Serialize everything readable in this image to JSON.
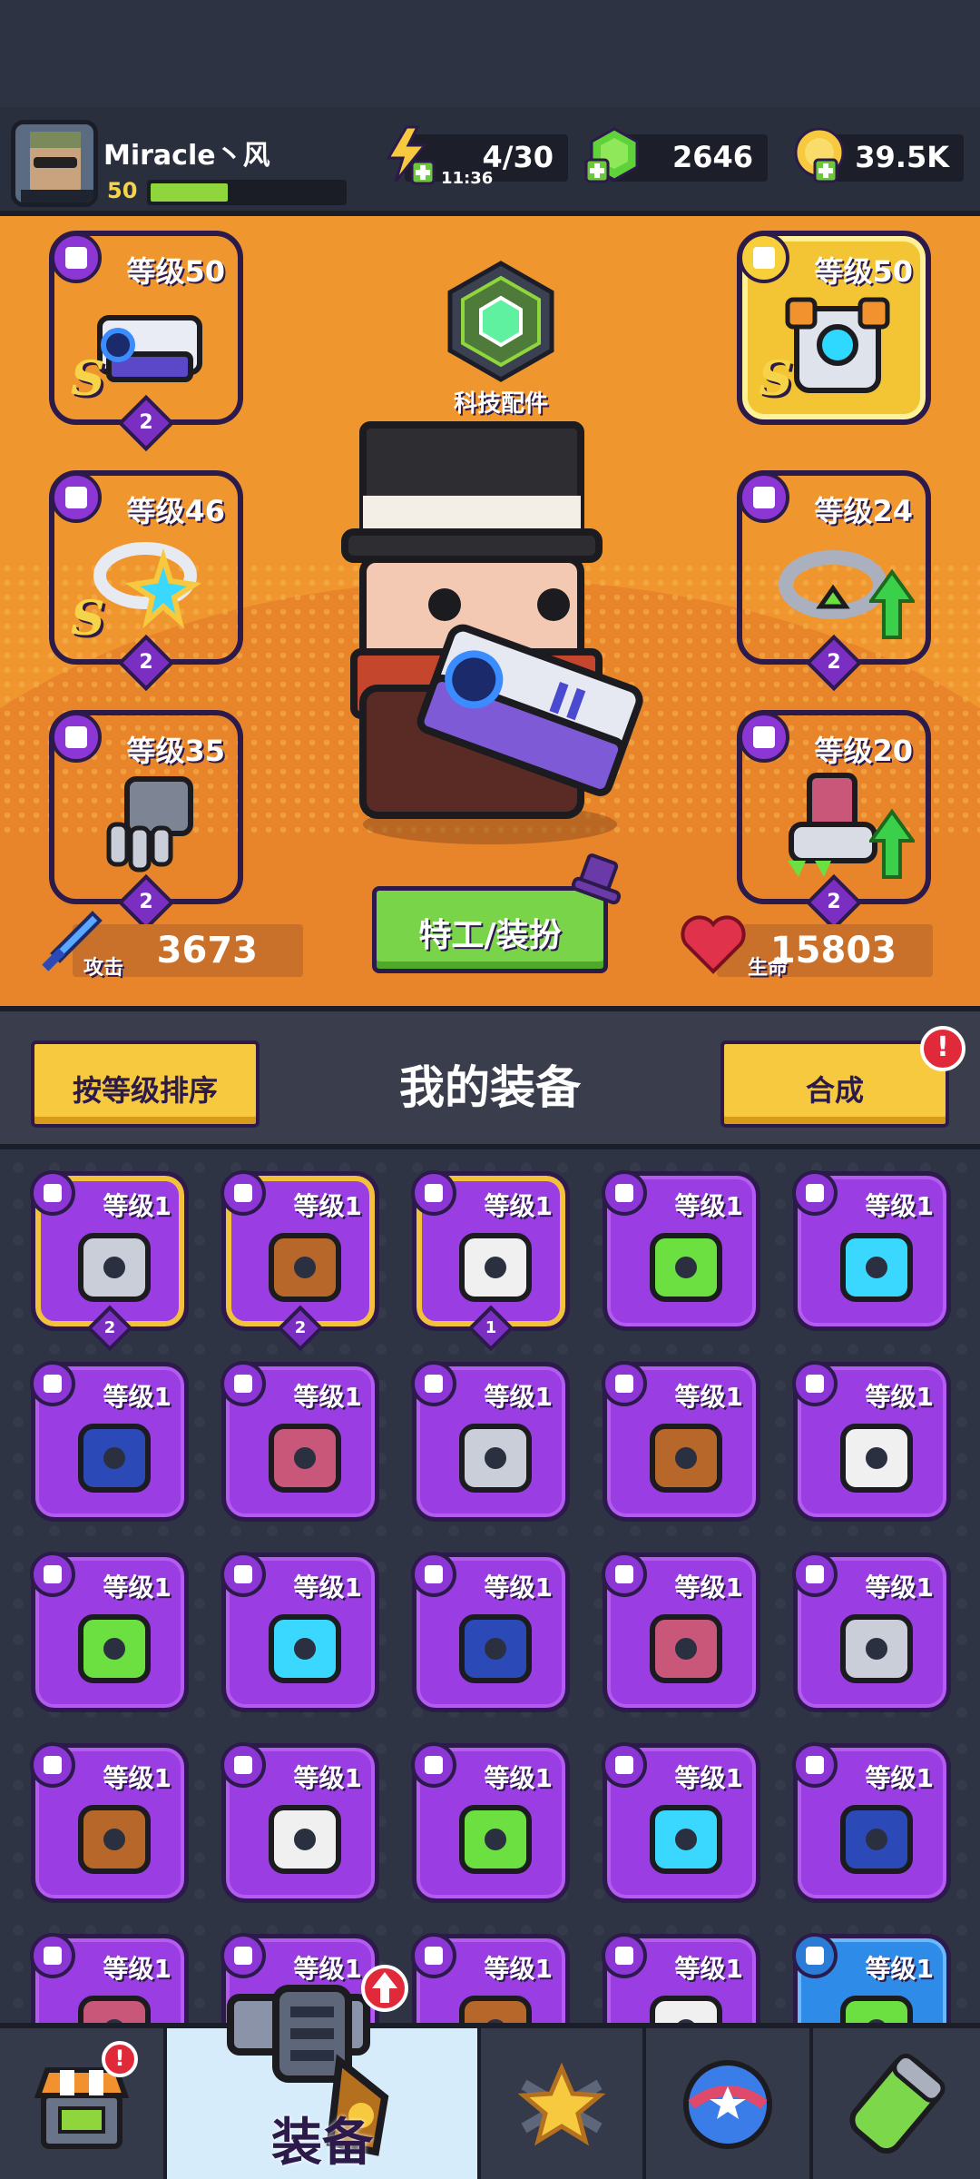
{
  "player": {
    "name": "Miracle丶风",
    "level": "50",
    "xp_fraction": 0.4
  },
  "resources": {
    "energy": {
      "value": "4/30",
      "timer": "11:36",
      "icon": "lightning-plus-icon"
    },
    "gems": {
      "value": "2646",
      "icon": "green-gem-plus-icon"
    },
    "coins": {
      "value": "39.5K",
      "icon": "gold-coin-plus-icon"
    }
  },
  "tech": {
    "label": "科技配件",
    "icon": "tech-hexagon-icon"
  },
  "equipped": [
    {
      "slot": "weapon",
      "level": "等级50",
      "rank": "S",
      "stars": "2",
      "frame": "purple",
      "icon": "laser-gun-icon",
      "upgrade": false
    },
    {
      "slot": "armor",
      "level": "等级50",
      "rank": "S",
      "stars": "",
      "frame": "gold",
      "icon": "mech-armor-icon",
      "upgrade": false
    },
    {
      "slot": "necklace",
      "level": "等级46",
      "rank": "S",
      "stars": "2",
      "frame": "purple",
      "icon": "star-ring-icon",
      "upgrade": false
    },
    {
      "slot": "belt",
      "level": "等级24",
      "rank": "",
      "stars": "2",
      "frame": "purple",
      "icon": "gem-belt-icon",
      "upgrade": true
    },
    {
      "slot": "glove",
      "level": "等级35",
      "rank": "",
      "stars": "2",
      "frame": "purple",
      "icon": "steel-gauntlet-icon",
      "upgrade": false
    },
    {
      "slot": "boots",
      "level": "等级20",
      "rank": "",
      "stars": "2",
      "frame": "purple",
      "icon": "claw-boots-icon",
      "upgrade": true
    }
  ],
  "stats": {
    "attack_label": "攻击",
    "attack": "3673",
    "hp_label": "生命",
    "hp": "15803"
  },
  "agent_button": "特工/装扮",
  "section": {
    "sort_button": "按等级排序",
    "title": "我的装备",
    "merge_button": "合成",
    "merge_alert": "!"
  },
  "inventory": [
    {
      "level": "等级1",
      "icon": "kunai-icon",
      "stars": "2",
      "selected": true
    },
    {
      "level": "等级1",
      "icon": "fang-necklace-icon",
      "stars": "2",
      "selected": true
    },
    {
      "level": "等级1",
      "icon": "fang-necklace-icon",
      "stars": "1",
      "selected": true
    },
    {
      "level": "等级1",
      "icon": "kunai-icon",
      "stars": "",
      "selected": false
    },
    {
      "level": "等级1",
      "icon": "scimitar-icon",
      "stars": "",
      "selected": false
    },
    {
      "level": "等级1",
      "icon": "scimitar-icon",
      "stars": "",
      "selected": false
    },
    {
      "level": "等级1",
      "icon": "revolver-icon",
      "stars": "",
      "selected": false
    },
    {
      "level": "等级1",
      "icon": "leaf-armor-icon",
      "stars": "",
      "selected": false
    },
    {
      "level": "等级1",
      "icon": "stone-armor-icon",
      "stars": "",
      "selected": false
    },
    {
      "level": "等级1",
      "icon": "robot-armor-icon",
      "stars": "",
      "selected": false
    },
    {
      "level": "等级1",
      "icon": "chain-vest-icon",
      "stars": "",
      "selected": false
    },
    {
      "level": "等级1",
      "icon": "gold-belt-icon",
      "stars": "",
      "selected": false
    },
    {
      "level": "等级1",
      "icon": "star-belt-icon",
      "stars": "",
      "selected": false
    },
    {
      "level": "等级1",
      "icon": "frost-claw-icon",
      "stars": "",
      "selected": false
    },
    {
      "level": "等级1",
      "icon": "frost-claw-icon",
      "stars": "",
      "selected": false
    },
    {
      "level": "等级1",
      "icon": "blue-gauntlet-icon",
      "stars": "",
      "selected": false
    },
    {
      "level": "等级1",
      "icon": "green-gauntlet-icon",
      "stars": "",
      "selected": false
    },
    {
      "level": "等级1",
      "icon": "green-gauntlet-icon",
      "stars": "",
      "selected": false
    },
    {
      "level": "等级1",
      "icon": "claw-boots-icon",
      "stars": "",
      "selected": false
    },
    {
      "level": "等级1",
      "icon": "claw-boots-icon",
      "stars": "",
      "selected": false
    },
    {
      "level": "等级1",
      "icon": "boots-icon",
      "stars": "",
      "selected": false
    },
    {
      "level": "等级1",
      "icon": "boots-icon",
      "stars": "",
      "selected": false
    },
    {
      "level": "等级1",
      "icon": "boots-icon",
      "stars": "",
      "selected": false
    },
    {
      "level": "等级1",
      "icon": "boots-icon",
      "stars": "",
      "selected": false
    },
    {
      "level": "等级1",
      "icon": "blue-weapon-icon",
      "stars": "",
      "selected": false,
      "blue": true
    }
  ],
  "nav": [
    {
      "id": "shop",
      "label": "",
      "icon": "shop-icon",
      "alert": "!"
    },
    {
      "id": "equipment",
      "label": "装备",
      "icon": "revolver-icon",
      "active": true
    },
    {
      "id": "battle",
      "label": "",
      "icon": "crossed-swords-star-icon"
    },
    {
      "id": "world",
      "label": "",
      "icon": "star-planet-icon"
    },
    {
      "id": "lab",
      "label": "",
      "icon": "dna-capsule-icon"
    }
  ],
  "colors": {
    "hero_bg": "#f0962e",
    "purple": "#9a3de2",
    "gold": "#f3c434",
    "green": "#79d44a"
  }
}
